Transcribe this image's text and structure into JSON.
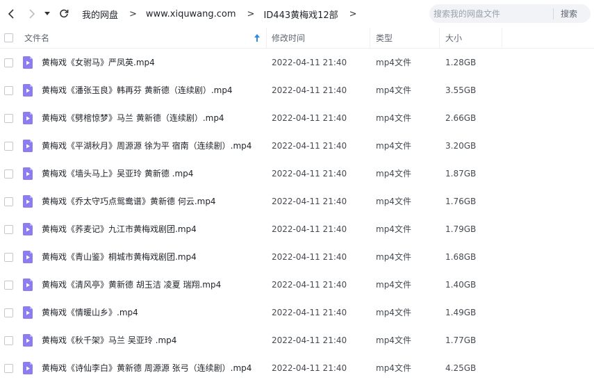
{
  "breadcrumb": {
    "items": [
      "我的网盘",
      "www.xiquwang.com",
      "ID443黄梅戏12部"
    ],
    "separator": ">"
  },
  "search": {
    "placeholder": "搜索我的网盘文件",
    "button_label": "搜索"
  },
  "columns": {
    "name": "文件名",
    "modified": "修改时间",
    "type": "类型",
    "size": "大小"
  },
  "colors": {
    "accent": "#2f8ae6",
    "file_icon": "#8b7cf0"
  },
  "files": [
    {
      "name": "黄梅戏《女驸马》严凤英.mp4",
      "modified": "2022-04-11 21:40",
      "type": "mp4文件",
      "size": "1.28GB"
    },
    {
      "name": "黄梅戏《潘张玉良》韩再芬 黄新德（连续剧）.mp4",
      "modified": "2022-04-11 21:40",
      "type": "mp4文件",
      "size": "3.55GB"
    },
    {
      "name": "黄梅戏《劈棺惊梦》马兰 黄新德（连续剧）.mp4",
      "modified": "2022-04-11 21:40",
      "type": "mp4文件",
      "size": "2.66GB"
    },
    {
      "name": "黄梅戏《平湖秋月》周源源 徐为平 宿南（连续剧）.mp4",
      "modified": "2022-04-11 21:40",
      "type": "mp4文件",
      "size": "3.20GB"
    },
    {
      "name": "黄梅戏《墙头马上》吴亚玲 黄新德 .mp4",
      "modified": "2022-04-11 21:40",
      "type": "mp4文件",
      "size": "1.87GB"
    },
    {
      "name": "黄梅戏《乔太守巧点鸳鸯谱》黄新德 何云.mp4",
      "modified": "2022-04-11 21:40",
      "type": "mp4文件",
      "size": "1.76GB"
    },
    {
      "name": "黄梅戏《荞麦记》九江市黄梅戏剧团.mp4",
      "modified": "2022-04-11 21:40",
      "type": "mp4文件",
      "size": "1.79GB"
    },
    {
      "name": "黄梅戏《青山鉴》桐城市黄梅戏剧团.mp4",
      "modified": "2022-04-11 21:40",
      "type": "mp4文件",
      "size": "1.68GB"
    },
    {
      "name": "黄梅戏《清风亭》黄新德 胡玉洁 凌夏 瑞翔.mp4",
      "modified": "2022-04-11 21:40",
      "type": "mp4文件",
      "size": "1.40GB"
    },
    {
      "name": "黄梅戏《情暖山乡》.mp4",
      "modified": "2022-04-11 21:40",
      "type": "mp4文件",
      "size": "1.49GB"
    },
    {
      "name": "黄梅戏《秋千架》马兰 吴亚玲 .mp4",
      "modified": "2022-04-11 21:40",
      "type": "mp4文件",
      "size": "1.77GB"
    },
    {
      "name": "黄梅戏《诗仙李白》黄新德 周源源 张弓（连续剧）.mp4",
      "modified": "2022-04-11 21:40",
      "type": "mp4文件",
      "size": "4.25GB"
    }
  ]
}
